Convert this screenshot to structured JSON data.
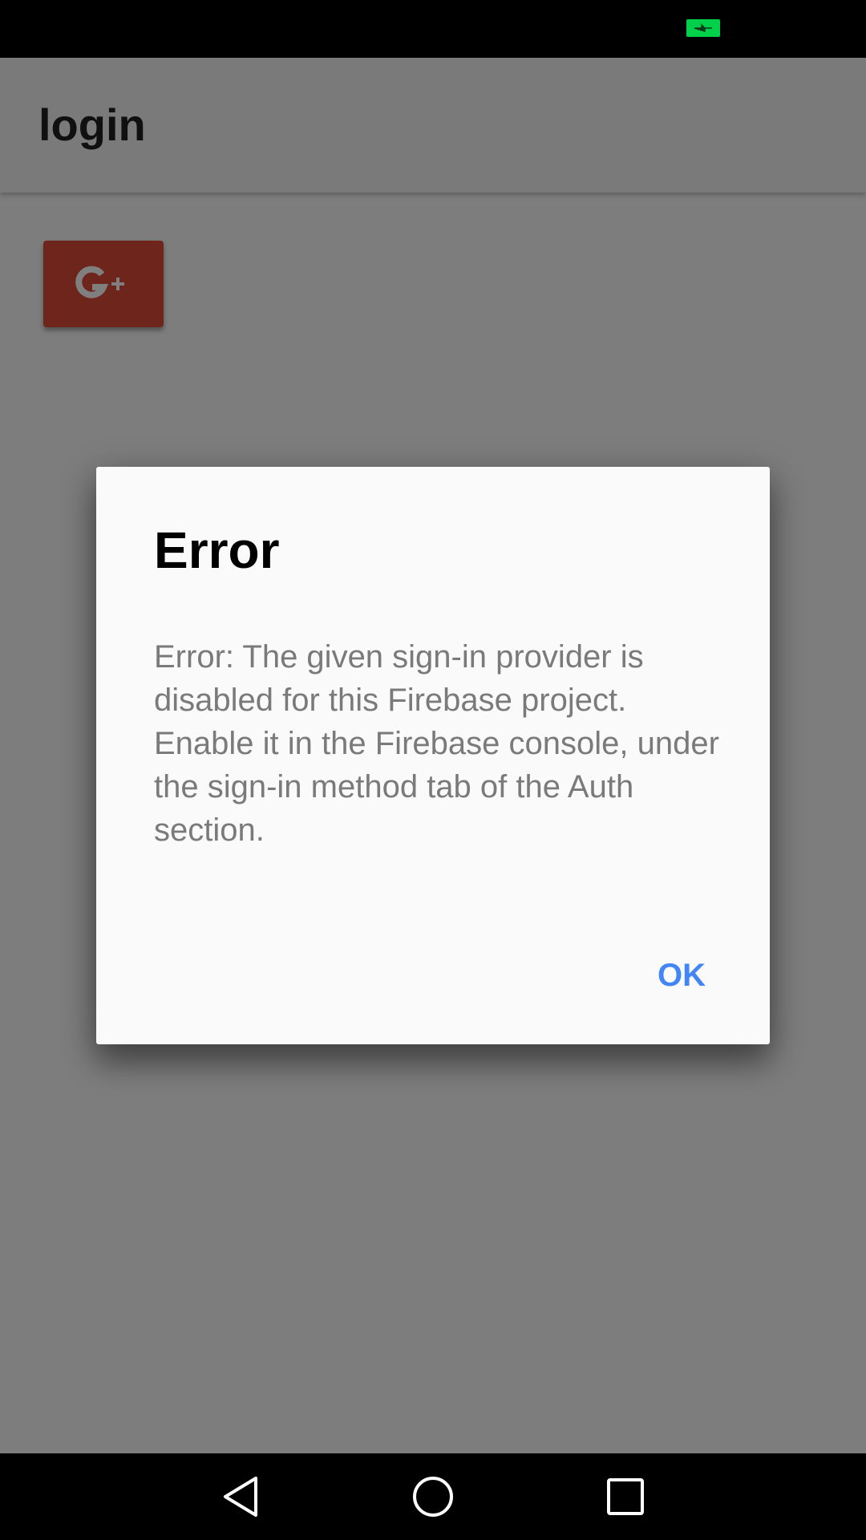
{
  "toolbar": {
    "title": "login"
  },
  "google_button": {
    "icon": "google-plus-icon",
    "label": "G+",
    "color": "#dd4b39"
  },
  "dialog": {
    "title": "Error",
    "message": "Error: The given sign-in provider is disabled for this Firebase project. Enable it in the Firebase console, under the sign-in method tab of the Auth section.",
    "ok_label": "OK",
    "accent_color": "#4285f4"
  },
  "status_bar": {
    "battery_icon": "battery-charging-icon",
    "battery_color": "#00d04a"
  },
  "nav_bar": {
    "back_icon": "back-triangle-icon",
    "home_icon": "home-circle-icon",
    "recents_icon": "recents-square-icon"
  }
}
